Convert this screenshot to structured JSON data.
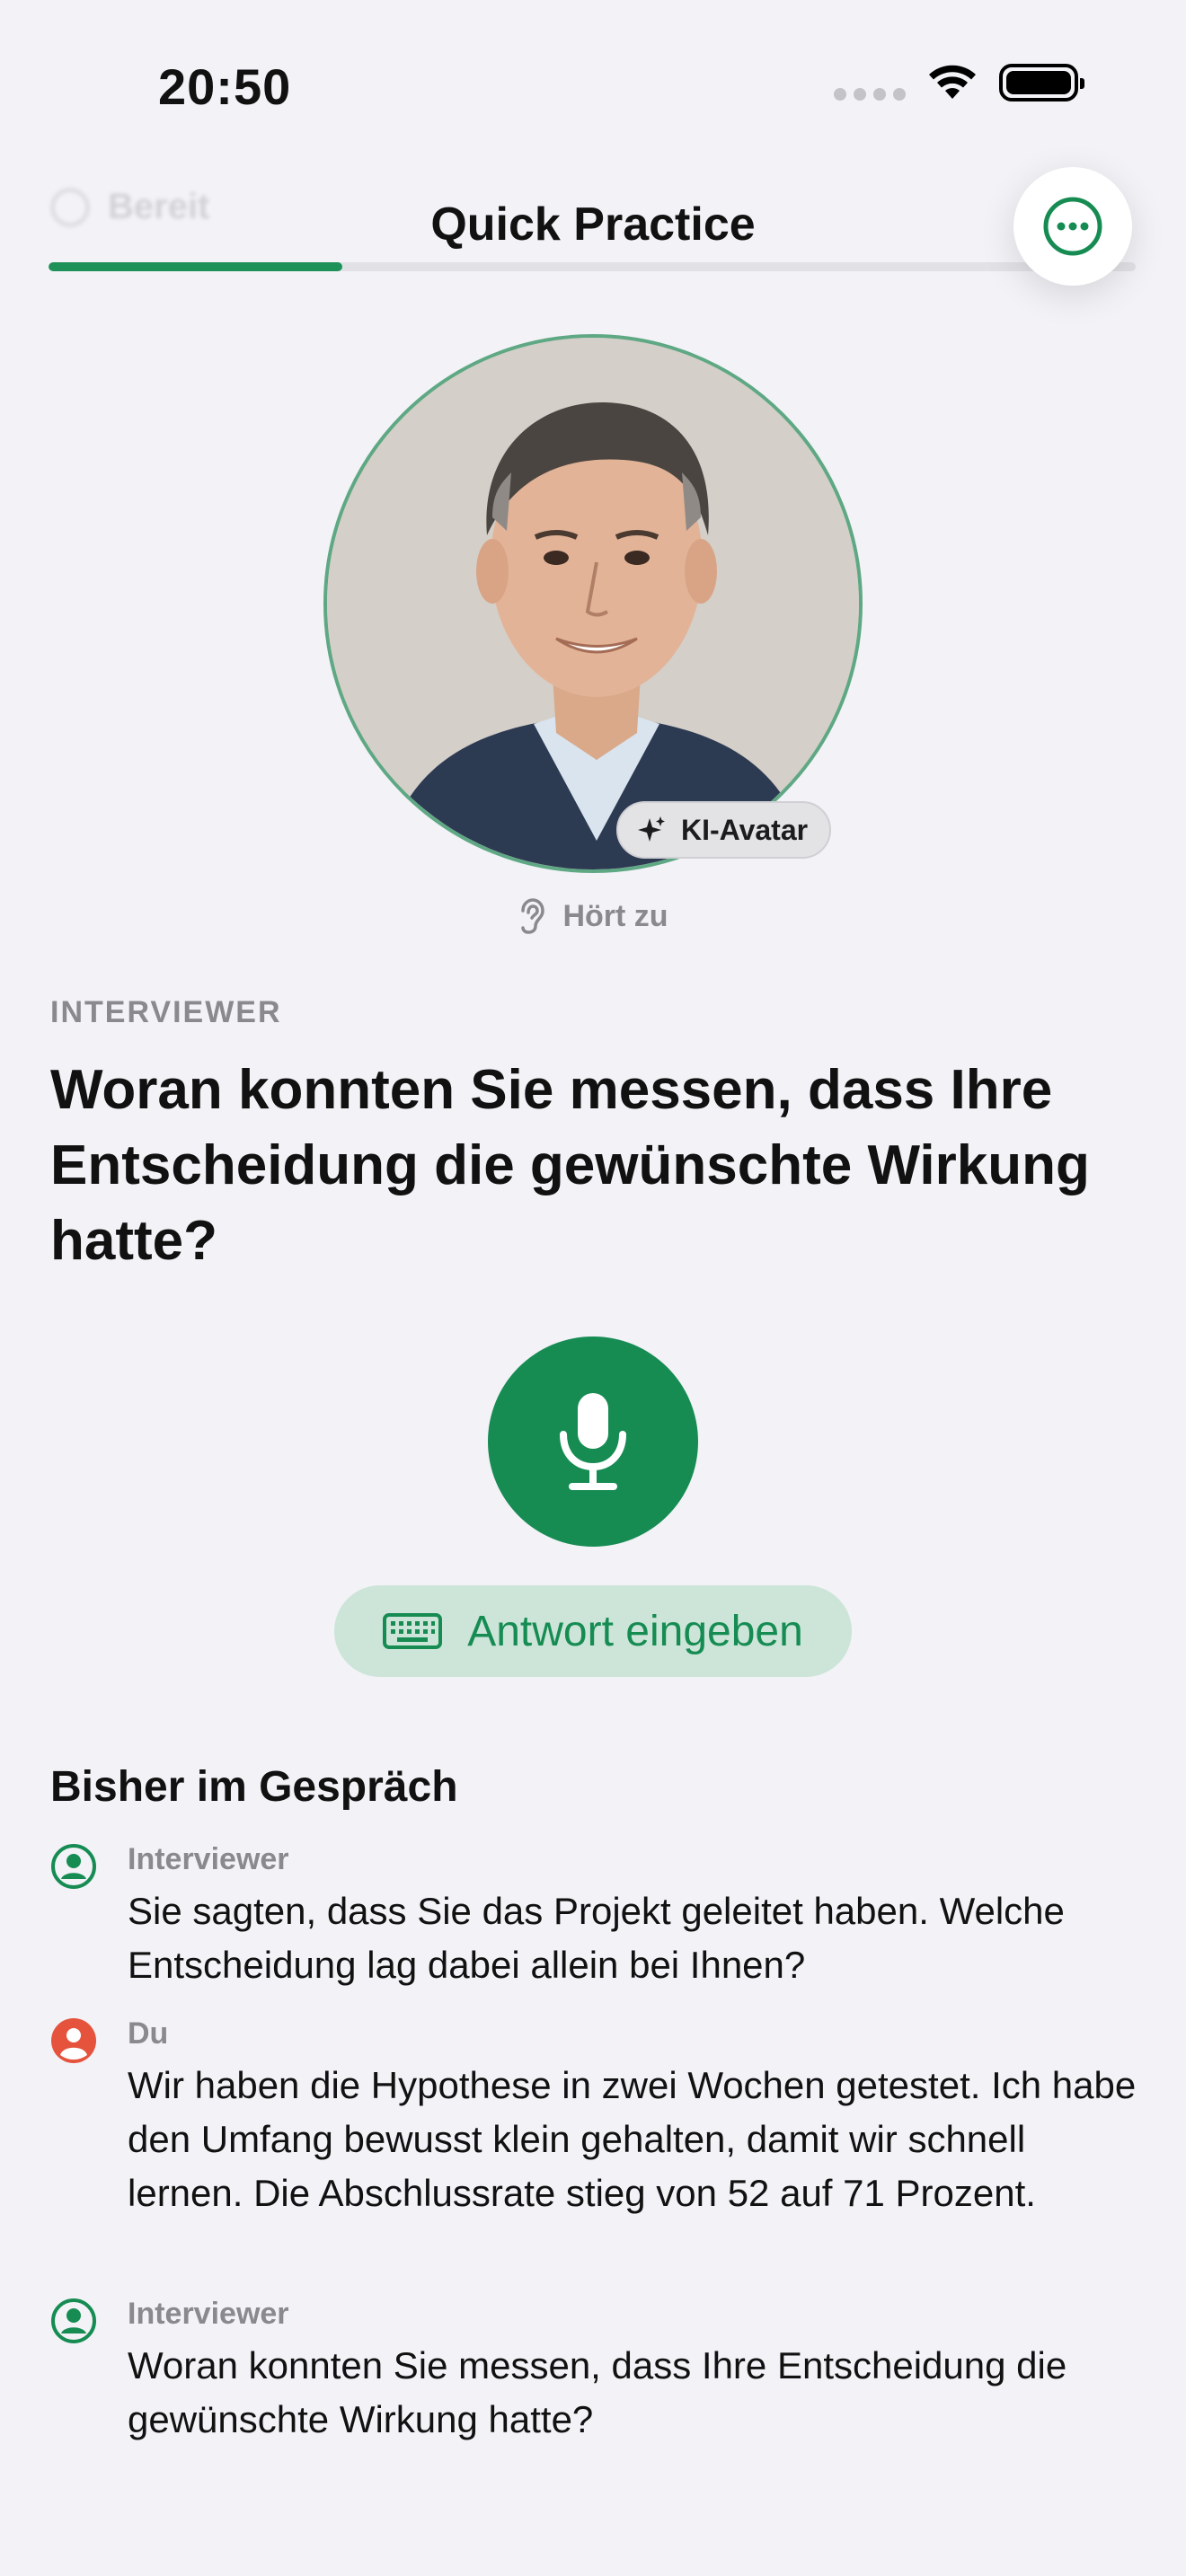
{
  "status_bar": {
    "time": "20:50"
  },
  "header": {
    "title": "Quick Practice",
    "ghost_status": "Bereit",
    "progress_fraction": 0.27
  },
  "avatar": {
    "badge_label": "KI-Avatar",
    "state_label": "Hört zu"
  },
  "question": {
    "role_label": "INTERVIEWER",
    "text": "Woran konnten Sie messen, dass Ihre Entscheidung die gewünschte Wirkung hatte?"
  },
  "actions": {
    "type_answer_label": "Antwort eingeben"
  },
  "transcript": {
    "title": "Bisher im Gespräch",
    "entries": [
      {
        "speaker": "Interviewer",
        "text": "Sie sagten, dass Sie das Projekt geleitet haben. Welche Entscheidung lag dabei allein bei Ihnen?"
      },
      {
        "speaker": "Du",
        "text": "Wir haben die Hypothese in zwei Wochen getestet. Ich habe den Umfang bewusst klein gehalten, damit wir schnell lernen. Die Abschlussrate stieg von 52 auf 71 Prozent."
      },
      {
        "speaker": "Interviewer",
        "text": "Woran konnten Sie messen, dass Ihre Entscheidung die gewünschte Wirkung hatte?"
      }
    ]
  },
  "colors": {
    "accent": "#168C53",
    "user": "#E5533D",
    "muted": "#8A8A8E"
  }
}
